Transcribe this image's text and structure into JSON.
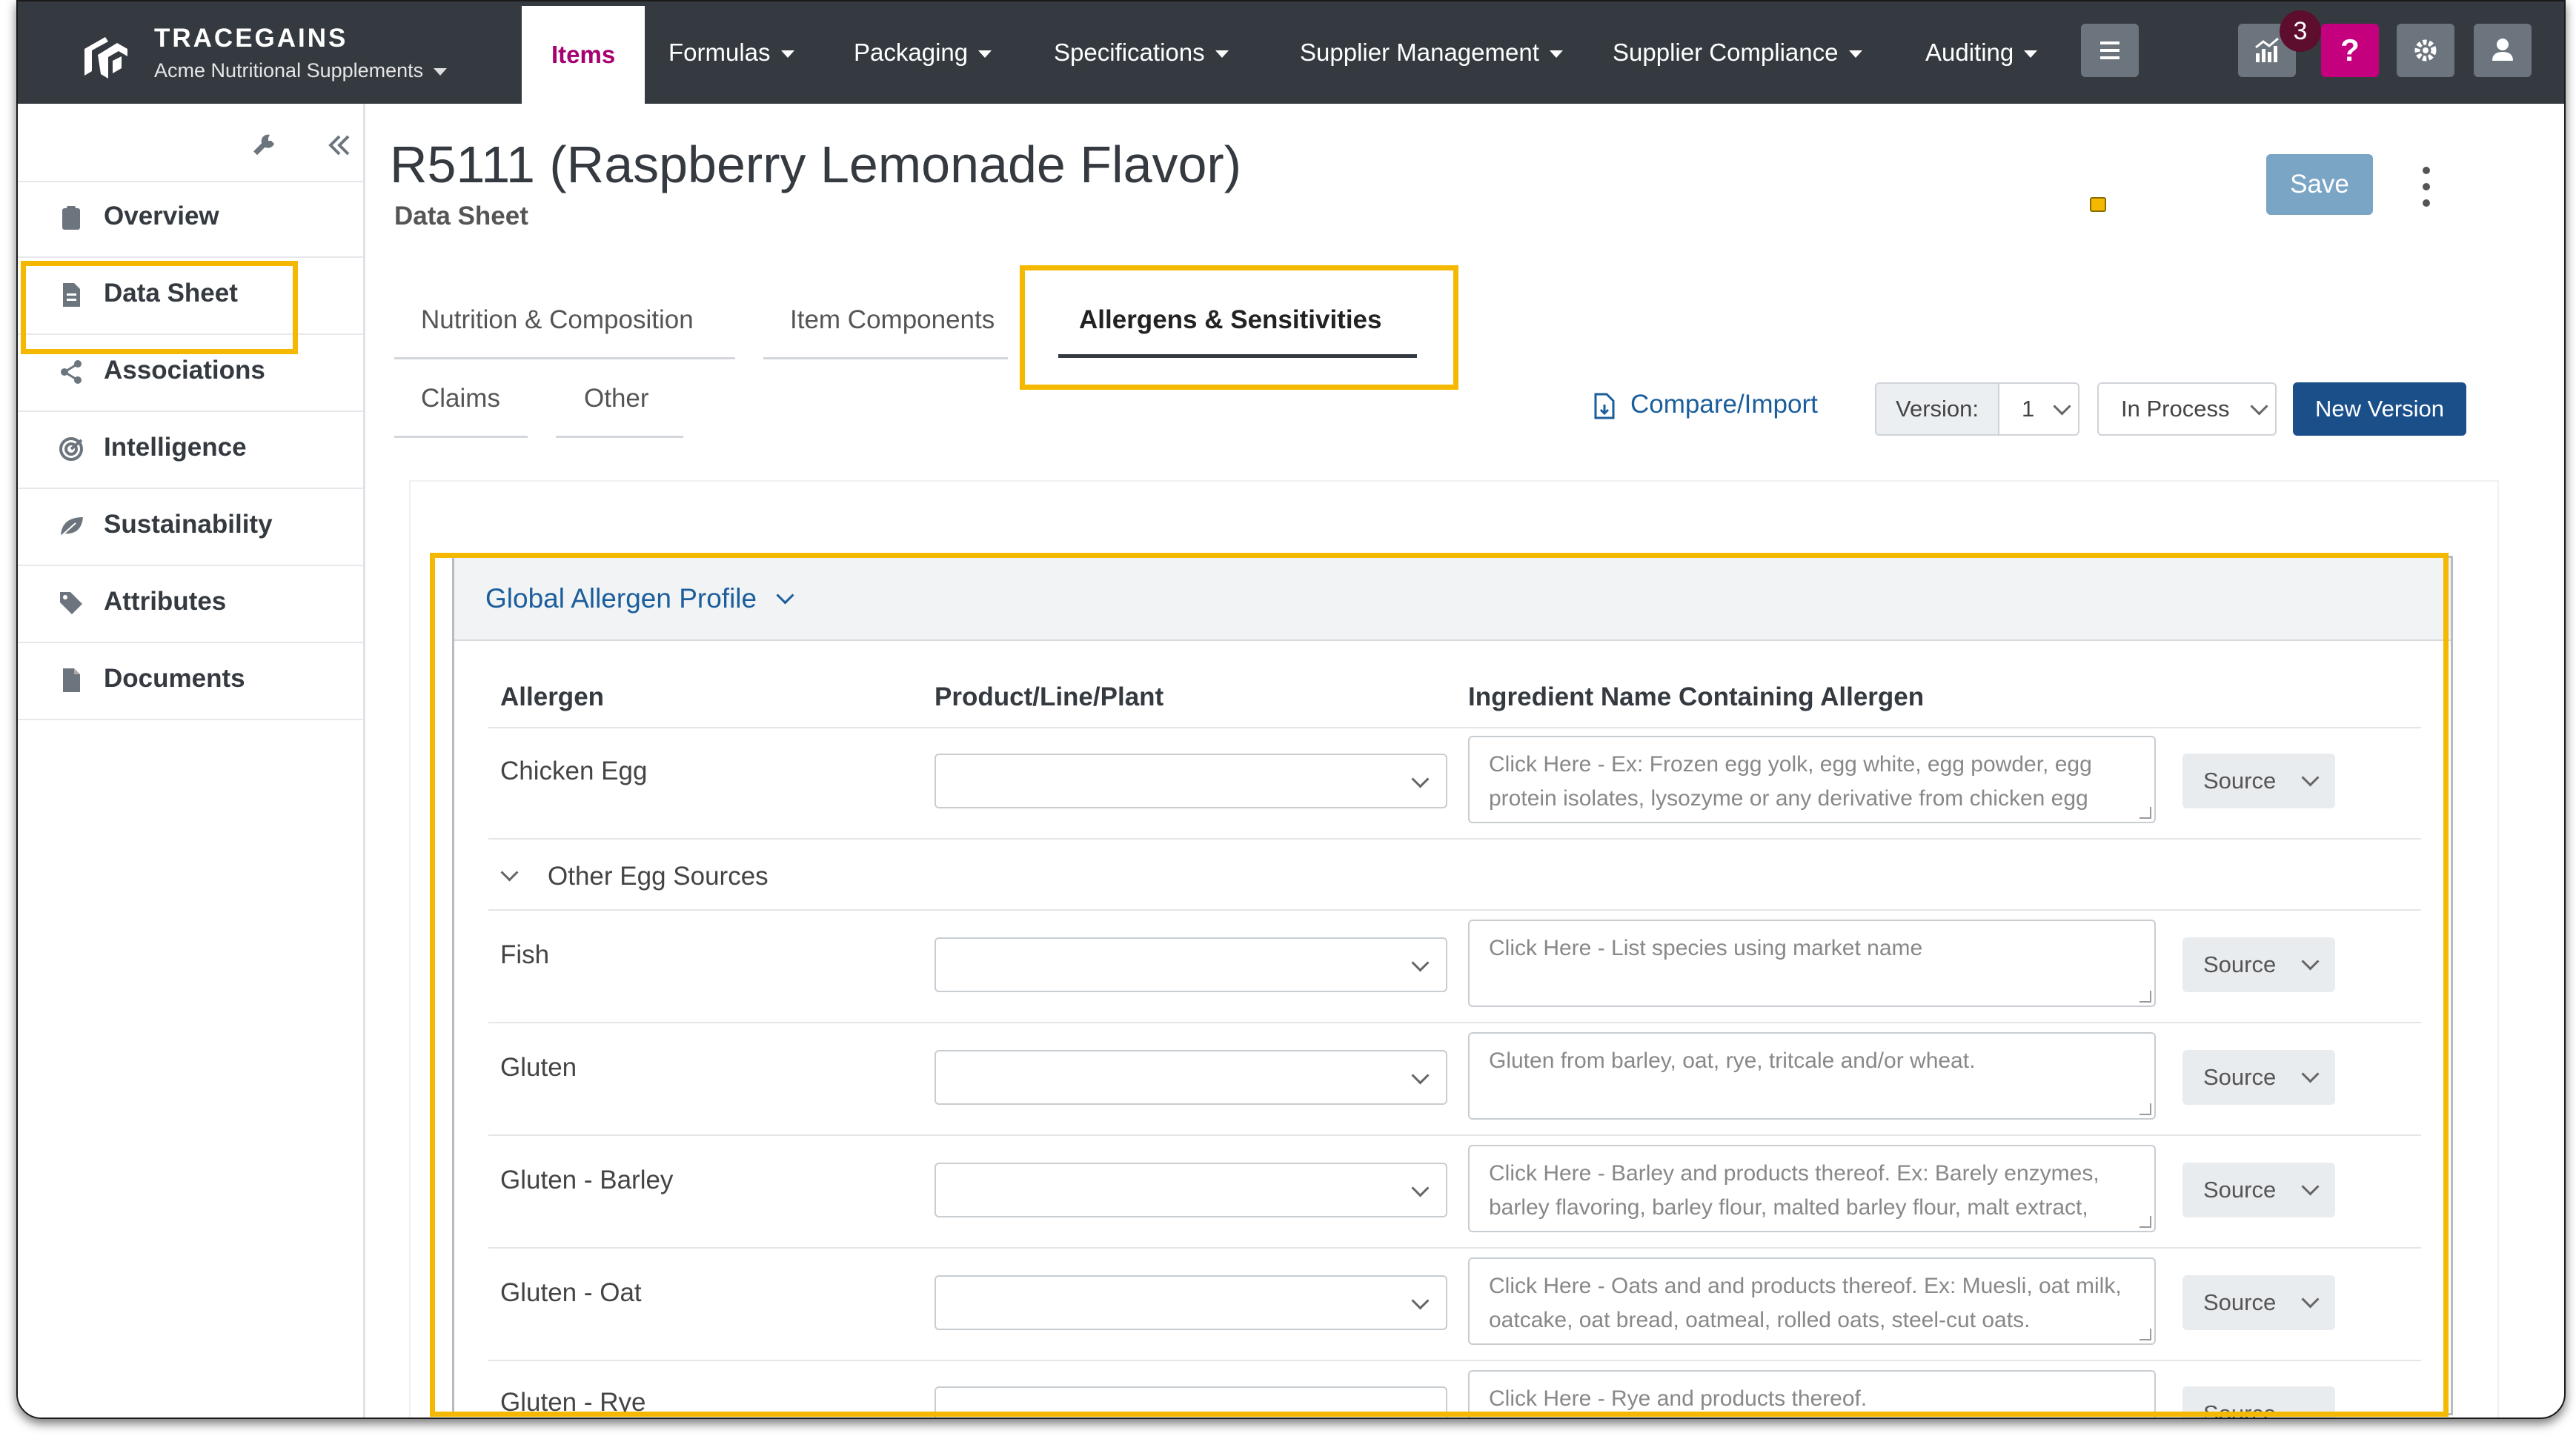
{
  "brand": {
    "name": "TRACEGAINS",
    "org": "Acme Nutritional Supplements"
  },
  "nav": {
    "items": [
      "Items",
      "Formulas",
      "Packaging",
      "Specifications",
      "Supplier Management",
      "Supplier Compliance",
      "Auditing"
    ],
    "active": "Items",
    "notification_count": "3",
    "help_label": "?"
  },
  "sidebar": {
    "items": [
      {
        "label": "Overview",
        "icon": "clipboard-icon"
      },
      {
        "label": "Data Sheet",
        "icon": "document-icon"
      },
      {
        "label": "Associations",
        "icon": "share-icon"
      },
      {
        "label": "Intelligence",
        "icon": "radar-icon"
      },
      {
        "label": "Sustainability",
        "icon": "leaf-icon"
      },
      {
        "label": "Attributes",
        "icon": "tag-icon"
      },
      {
        "label": "Documents",
        "icon": "file-icon"
      }
    ]
  },
  "page": {
    "title": "R5111 (Raspberry Lemonade Flavor)",
    "subtitle": "Data Sheet",
    "save_label": "Save"
  },
  "tabs": {
    "row1": [
      "Nutrition & Composition",
      "Item Components",
      "Allergens & Sensitivities"
    ],
    "row2": [
      "Claims",
      "Other"
    ],
    "active": "Allergens & Sensitivities"
  },
  "toolbar": {
    "compare_label": "Compare/Import",
    "version_label": "Version:",
    "version_value": "1",
    "status_value": "In Process",
    "new_version_label": "New Version"
  },
  "profile": {
    "title": "Global Allergen Profile",
    "columns": [
      "Allergen",
      "Product/Line/Plant",
      "Ingredient Name Containing Allergen"
    ],
    "source_label": "Source",
    "subsection": "Other Egg Sources",
    "rows": [
      {
        "allergen": "Chicken Egg",
        "placeholder": "Click Here - Ex: Frozen egg yolk, egg white, egg powder, egg protein isolates, lysozyme or any derivative from chicken egg"
      },
      {
        "allergen": "Fish",
        "placeholder": "Click Here - List species using market name"
      },
      {
        "allergen": "Gluten",
        "placeholder": "Gluten from barley, oat, rye, tritcale and/or wheat."
      },
      {
        "allergen": "Gluten - Barley",
        "placeholder": "Click Here - Barley and products thereof. Ex: Barely enzymes, barley flavoring, barley flour, malted barley flour, malt extract,"
      },
      {
        "allergen": "Gluten - Oat",
        "placeholder": "Click Here - Oats and and products thereof. Ex: Muesli, oat milk, oatcake, oat bread, oatmeal, rolled oats, steel-cut oats."
      },
      {
        "allergen": "Gluten - Rye",
        "placeholder": "Click Here - Rye and products thereof."
      }
    ]
  },
  "colors": {
    "nav_bg": "#343a40",
    "accent": "#a5006f",
    "highlight": "#f5b800",
    "primary": "#1b4f8a",
    "link": "#1b5e9c"
  }
}
